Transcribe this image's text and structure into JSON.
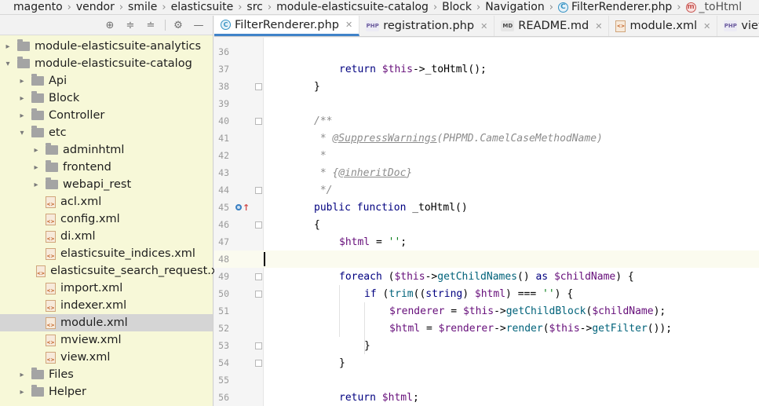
{
  "breadcrumb": [
    {
      "label": "magento",
      "icon": ""
    },
    {
      "label": "vendor",
      "icon": ""
    },
    {
      "label": "smile",
      "icon": ""
    },
    {
      "label": "elasticsuite",
      "icon": ""
    },
    {
      "label": "src",
      "icon": ""
    },
    {
      "label": "module-elasticsuite-catalog",
      "icon": ""
    },
    {
      "label": "Block",
      "icon": ""
    },
    {
      "label": "Navigation",
      "icon": ""
    },
    {
      "label": "FilterRenderer.php",
      "icon": "class-icon"
    },
    {
      "label": "_toHtml",
      "icon": "method-icon"
    }
  ],
  "project": {
    "toolbar_icons": [
      "locate-icon",
      "expand-all-icon",
      "collapse-all-icon",
      "gear-icon",
      "hide-icon"
    ],
    "tree": [
      {
        "label": "module-elasticsuite-analytics",
        "type": "folder",
        "depth": 0,
        "expanded": false
      },
      {
        "label": "module-elasticsuite-catalog",
        "type": "folder",
        "depth": 0,
        "expanded": true
      },
      {
        "label": "Api",
        "type": "folder",
        "depth": 1,
        "expanded": false
      },
      {
        "label": "Block",
        "type": "folder",
        "depth": 1,
        "expanded": false
      },
      {
        "label": "Controller",
        "type": "folder",
        "depth": 1,
        "expanded": false
      },
      {
        "label": "etc",
        "type": "folder",
        "depth": 1,
        "expanded": true
      },
      {
        "label": "adminhtml",
        "type": "folder",
        "depth": 2,
        "expanded": false
      },
      {
        "label": "frontend",
        "type": "folder",
        "depth": 2,
        "expanded": false
      },
      {
        "label": "webapi_rest",
        "type": "folder",
        "depth": 2,
        "expanded": false
      },
      {
        "label": "acl.xml",
        "type": "xml",
        "depth": 2
      },
      {
        "label": "config.xml",
        "type": "xml",
        "depth": 2
      },
      {
        "label": "di.xml",
        "type": "xml",
        "depth": 2
      },
      {
        "label": "elasticsuite_indices.xml",
        "type": "xml",
        "depth": 2
      },
      {
        "label": "elasticsuite_search_request.x",
        "type": "xml",
        "depth": 2
      },
      {
        "label": "import.xml",
        "type": "xml",
        "depth": 2
      },
      {
        "label": "indexer.xml",
        "type": "xml",
        "depth": 2
      },
      {
        "label": "module.xml",
        "type": "xml",
        "depth": 2,
        "selected": true
      },
      {
        "label": "mview.xml",
        "type": "xml",
        "depth": 2
      },
      {
        "label": "view.xml",
        "type": "xml",
        "depth": 2
      },
      {
        "label": "Files",
        "type": "folder",
        "depth": 1,
        "expanded": false
      },
      {
        "label": "Helper",
        "type": "folder",
        "depth": 1,
        "expanded": false
      }
    ]
  },
  "tabs": [
    {
      "label": "FilterRenderer.php",
      "icon": "class-icon",
      "active": true
    },
    {
      "label": "registration.php",
      "icon": "php-file-icon",
      "active": false
    },
    {
      "label": "README.md",
      "icon": "markdown-file-icon",
      "active": false
    },
    {
      "label": "module.xml",
      "icon": "xml-file-icon",
      "active": false
    },
    {
      "label": "view.phtm",
      "icon": "php-file-icon",
      "active": false
    }
  ],
  "editor": {
    "current_line": "48",
    "lines": [
      {
        "n": "36",
        "indent": 2,
        "tokens": []
      },
      {
        "n": "37",
        "indent": 2,
        "tokens": [
          [
            "kw",
            "return "
          ],
          [
            "var",
            "$this"
          ],
          [
            "plain",
            "->"
          ],
          [
            "plain",
            "_toHtml();"
          ]
        ]
      },
      {
        "n": "38",
        "indent": 1,
        "tokens": [
          [
            "plain",
            "}"
          ]
        ],
        "fold": true
      },
      {
        "n": "39",
        "indent": 0,
        "tokens": []
      },
      {
        "n": "40",
        "indent": 1,
        "tokens": [
          [
            "cmt",
            "/**"
          ]
        ],
        "fold": true
      },
      {
        "n": "41",
        "indent": 1,
        "tokens": [
          [
            "cmt",
            " * "
          ],
          [
            "tag",
            "@SuppressWarnings"
          ],
          [
            "cmt",
            "(PHPMD.CamelCaseMethodName)"
          ]
        ]
      },
      {
        "n": "42",
        "indent": 1,
        "tokens": [
          [
            "cmt",
            " *"
          ]
        ]
      },
      {
        "n": "43",
        "indent": 1,
        "tokens": [
          [
            "cmt",
            " * {"
          ],
          [
            "tag",
            "@inheritDoc"
          ],
          [
            "cmt",
            "}"
          ]
        ]
      },
      {
        "n": "44",
        "indent": 1,
        "tokens": [
          [
            "cmt",
            " */"
          ]
        ],
        "fold": true
      },
      {
        "n": "45",
        "indent": 1,
        "tokens": [
          [
            "kw",
            "public function "
          ],
          [
            "plain",
            "_toHtml()"
          ]
        ],
        "marker": true
      },
      {
        "n": "46",
        "indent": 1,
        "tokens": [
          [
            "plain",
            "{"
          ]
        ],
        "fold": true
      },
      {
        "n": "47",
        "indent": 2,
        "tokens": [
          [
            "var",
            "$html"
          ],
          [
            "plain",
            " = "
          ],
          [
            "str",
            "''"
          ],
          [
            "plain",
            ";"
          ]
        ]
      },
      {
        "n": "48",
        "indent": 0,
        "tokens": []
      },
      {
        "n": "49",
        "indent": 2,
        "tokens": [
          [
            "kw",
            "foreach "
          ],
          [
            "plain",
            "("
          ],
          [
            "var",
            "$this"
          ],
          [
            "plain",
            "->"
          ],
          [
            "fn",
            "getChildNames"
          ],
          [
            "plain",
            "() "
          ],
          [
            "kw",
            "as "
          ],
          [
            "var",
            "$childName"
          ],
          [
            "plain",
            ") {"
          ]
        ],
        "fold": true
      },
      {
        "n": "50",
        "indent": 3,
        "tokens": [
          [
            "kw",
            "if "
          ],
          [
            "plain",
            "("
          ],
          [
            "fn",
            "trim"
          ],
          [
            "plain",
            "(("
          ],
          [
            "kw",
            "string"
          ],
          [
            "plain",
            ") "
          ],
          [
            "var",
            "$html"
          ],
          [
            "plain",
            ") === "
          ],
          [
            "str",
            "''"
          ],
          [
            "plain",
            ") {"
          ]
        ],
        "fold": true
      },
      {
        "n": "51",
        "indent": 4,
        "tokens": [
          [
            "var",
            "$renderer"
          ],
          [
            "plain",
            " = "
          ],
          [
            "var",
            "$this"
          ],
          [
            "plain",
            "->"
          ],
          [
            "fn",
            "getChildBlock"
          ],
          [
            "plain",
            "("
          ],
          [
            "var",
            "$childName"
          ],
          [
            "plain",
            ");"
          ]
        ]
      },
      {
        "n": "52",
        "indent": 4,
        "tokens": [
          [
            "var",
            "$html"
          ],
          [
            "plain",
            " = "
          ],
          [
            "var",
            "$renderer"
          ],
          [
            "plain",
            "->"
          ],
          [
            "fn",
            "render"
          ],
          [
            "plain",
            "("
          ],
          [
            "var",
            "$this"
          ],
          [
            "plain",
            "->"
          ],
          [
            "fn",
            "getFilter"
          ],
          [
            "plain",
            "());"
          ]
        ]
      },
      {
        "n": "53",
        "indent": 3,
        "tokens": [
          [
            "plain",
            "}"
          ]
        ],
        "fold": true
      },
      {
        "n": "54",
        "indent": 2,
        "tokens": [
          [
            "plain",
            "}"
          ]
        ],
        "fold": true
      },
      {
        "n": "55",
        "indent": 0,
        "tokens": []
      },
      {
        "n": "56",
        "indent": 2,
        "tokens": [
          [
            "kw",
            "return "
          ],
          [
            "var",
            "$html"
          ],
          [
            "plain",
            ";"
          ]
        ]
      }
    ]
  }
}
